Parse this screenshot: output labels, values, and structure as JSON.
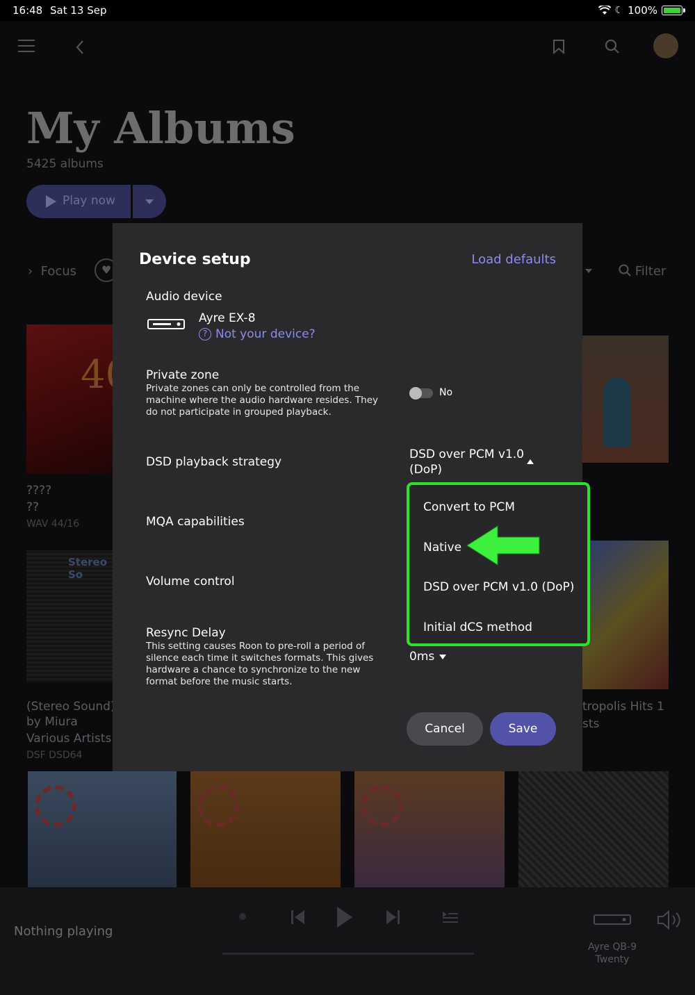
{
  "status": {
    "time": "16:48",
    "date": "Sat 13 Sep",
    "battery": "100%"
  },
  "header": {
    "title": "My Albums",
    "count": "5425 albums",
    "play_label": "Play now",
    "focus_label": "Focus",
    "filter_label": "Filter"
  },
  "albums": {
    "a1": {
      "title": "????",
      "artist": "??",
      "format": "WAV 44/16"
    },
    "a2": {
      "title": "(Stereo Sound) J",
      "title2": "by Miura",
      "artist": "Various Artists",
      "format": "DSF DSD64"
    },
    "a3": {
      "title": "tropolis Hits 1",
      "artist": "sts"
    }
  },
  "player": {
    "nothing": "Nothing playing",
    "zone_line1": "Ayre QB-9",
    "zone_line2": "Twenty"
  },
  "modal": {
    "title": "Device setup",
    "load_defaults": "Load defaults",
    "audio_device_label": "Audio device",
    "device_name": "Ayre EX-8",
    "not_your_device": "Not your device?",
    "private_zone_label": "Private zone",
    "private_zone_desc": "Private zones can only be controlled from the machine where the audio hardware resides. They do not participate in grouped playback.",
    "private_zone_value": "No",
    "dsd_label": "DSD playback strategy",
    "dsd_value_line1": "DSD over PCM v1.0",
    "dsd_value_line2": "(DoP)",
    "mqa_label": "MQA capabilities",
    "volume_label": "Volume control",
    "resync_label": "Resync Delay",
    "resync_desc": "This setting causes Roon to pre-roll a period of silence each time it switches formats. This gives hardware a chance to synchronize to the new format before the music starts.",
    "resync_value": "0ms",
    "cancel": "Cancel",
    "save": "Save"
  },
  "dropdown": {
    "options": [
      "Convert to PCM",
      "Native",
      "DSD over PCM v1.0 (DoP)",
      "Initial dCS method"
    ]
  },
  "colors": {
    "accent": "#8c8cf0",
    "save_button": "#5252a8",
    "highlight": "#2fe02f"
  }
}
